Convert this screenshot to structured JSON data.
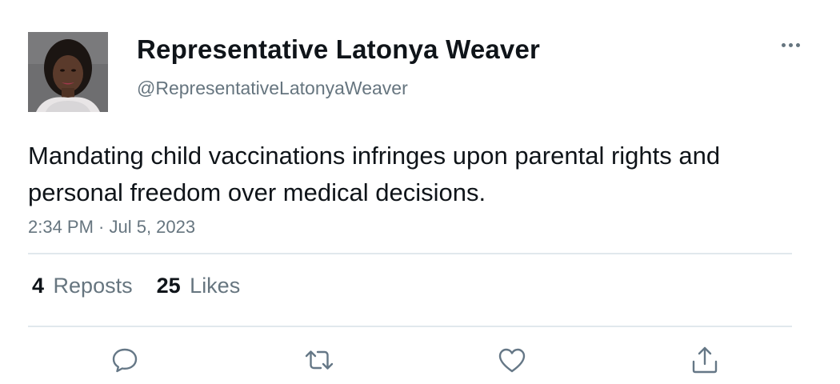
{
  "author": {
    "display_name": "Representative Latonya Weaver",
    "handle": "@RepresentativeLatonyaWeaver",
    "avatar_icon": "profile-photo"
  },
  "tweet": {
    "text": "Mandating child vaccinations infringes upon parental rights and personal freedom over medical decisions.",
    "timestamp": "2:34 PM · Jul 5, 2023"
  },
  "stats": {
    "reposts_count": "4",
    "reposts_label": "Reposts",
    "likes_count": "25",
    "likes_label": "Likes"
  },
  "actions": {
    "reply_icon": "reply-icon",
    "repost_icon": "repost-icon",
    "like_icon": "like-icon",
    "share_icon": "share-icon",
    "more_icon": "more-icon"
  },
  "colors": {
    "primary_text": "#0f1419",
    "secondary_text": "#66757f",
    "divider": "#e1e8ed",
    "icon": "#657786"
  }
}
